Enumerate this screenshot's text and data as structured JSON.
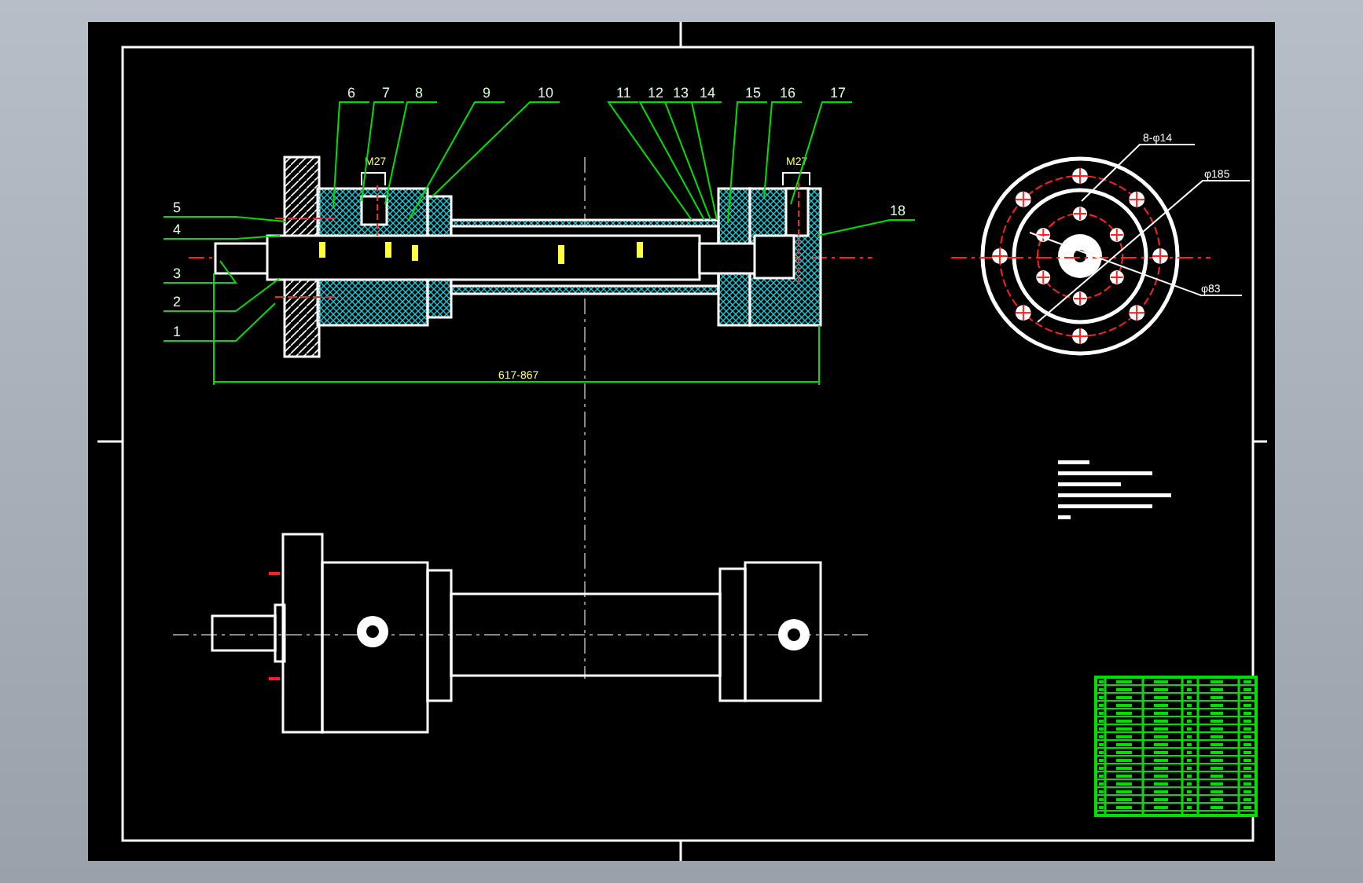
{
  "drawing": {
    "part_labels": [
      {
        "number": "6"
      },
      {
        "number": "7"
      },
      {
        "number": "8"
      },
      {
        "number": "9"
      },
      {
        "number": "10"
      },
      {
        "number": "11"
      },
      {
        "number": "12"
      },
      {
        "number": "13"
      },
      {
        "number": "14"
      },
      {
        "number": "15"
      },
      {
        "number": "16"
      },
      {
        "number": "17"
      },
      {
        "number": "18"
      },
      {
        "number": "5"
      },
      {
        "number": "4"
      },
      {
        "number": "3"
      },
      {
        "number": "2"
      },
      {
        "number": "1"
      }
    ],
    "thread_labels": [
      "M27",
      "M27"
    ],
    "overall_dimension": "617-867",
    "end_view_labels": [
      "8-φ14",
      "φ185",
      "φ83"
    ]
  }
}
